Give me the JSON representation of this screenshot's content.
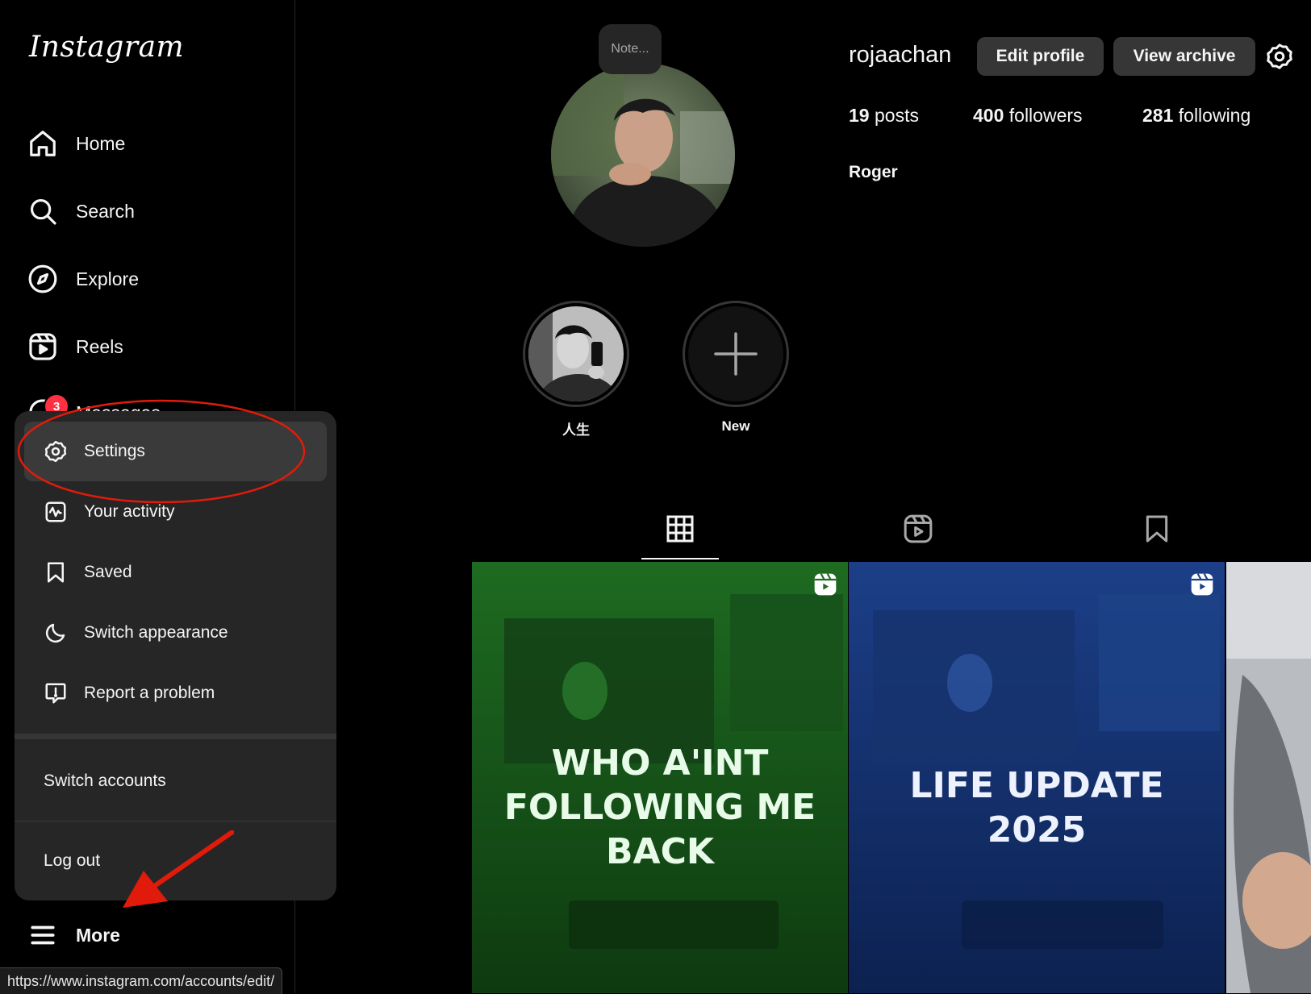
{
  "app": {
    "logo_text": "Instagram"
  },
  "sidebar": {
    "items": [
      {
        "label": "Home",
        "icon": "home-icon"
      },
      {
        "label": "Search",
        "icon": "search-icon"
      },
      {
        "label": "Explore",
        "icon": "compass-icon"
      },
      {
        "label": "Reels",
        "icon": "reels-icon"
      },
      {
        "label": "Messages",
        "icon": "messenger-icon",
        "badge": "3"
      }
    ],
    "more_label": "More"
  },
  "more_menu": {
    "items": [
      {
        "label": "Settings",
        "icon": "settings-icon",
        "active": true
      },
      {
        "label": "Your activity",
        "icon": "activity-icon"
      },
      {
        "label": "Saved",
        "icon": "bookmark-icon"
      },
      {
        "label": "Switch appearance",
        "icon": "moon-icon"
      },
      {
        "label": "Report a problem",
        "icon": "report-icon"
      }
    ],
    "switch_accounts": "Switch accounts",
    "log_out": "Log out"
  },
  "status_bar": {
    "url": "https://www.instagram.com/accounts/edit/"
  },
  "profile": {
    "note_placeholder": "Note...",
    "username": "rojaachan",
    "edit_profile": "Edit profile",
    "view_archive": "View archive",
    "stats": {
      "posts_count": "19",
      "posts_label": "posts",
      "followers_count": "400",
      "followers_label": "followers",
      "following_count": "281",
      "following_label": "following"
    },
    "full_name": "Roger"
  },
  "highlights": [
    {
      "label": "人生"
    },
    {
      "label": "New"
    }
  ],
  "tabs": [
    {
      "icon": "grid-icon",
      "active": true
    },
    {
      "icon": "reels-tab-icon",
      "active": false
    },
    {
      "icon": "saved-tab-icon",
      "active": false
    }
  ],
  "posts": [
    {
      "text_lines": [
        "WHO A'INT",
        "FOLLOWING ME",
        "BACK"
      ],
      "type": "reel",
      "color": "#1f6a1f"
    },
    {
      "text_lines": [
        "LIFE UPDATE",
        "2025"
      ],
      "type": "reel",
      "color": "#1b3f86"
    },
    {
      "text_lines": [],
      "type": "photo",
      "color": "#8a8a8a"
    }
  ],
  "colors": {
    "background": "#000000",
    "menu_bg": "#262626",
    "badge": "#ff3040",
    "annotation": "#e01b0b"
  }
}
